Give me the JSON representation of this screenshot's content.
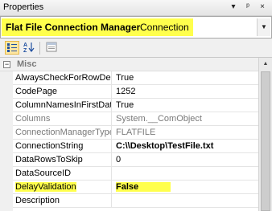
{
  "window": {
    "title": "Properties",
    "buttons": [
      "▾",
      "ᵖ",
      "×"
    ]
  },
  "object_selector": {
    "name": "Flat File Connection Manager",
    "type": "Connection",
    "highlight_color": "#ffff4d"
  },
  "toolbar": {
    "buttons": [
      {
        "name": "categorized-view-icon",
        "active": true
      },
      {
        "name": "alphabetical-sort-icon",
        "active": false
      },
      {
        "name": "property-pages-icon",
        "active": false
      }
    ]
  },
  "grid": {
    "category": {
      "toggle": "−",
      "label": "Misc"
    },
    "rows": [
      {
        "name": "AlwaysCheckForRowDelim",
        "value": "True",
        "readonly": false,
        "bold": false,
        "highlight": false
      },
      {
        "name": "CodePage",
        "value": "1252",
        "readonly": false,
        "bold": false,
        "highlight": false
      },
      {
        "name": "ColumnNamesInFirstDataRow",
        "value": "True",
        "readonly": false,
        "bold": false,
        "highlight": false
      },
      {
        "name": "Columns",
        "value": "System.__ComObject",
        "readonly": true,
        "bold": false,
        "highlight": false
      },
      {
        "name": "ConnectionManagerType",
        "value": "FLATFILE",
        "readonly": true,
        "bold": false,
        "highlight": false
      },
      {
        "name": "ConnectionString",
        "value": "C:\\\\Desktop\\TestFile.txt",
        "readonly": false,
        "bold": true,
        "highlight": false
      },
      {
        "name": "DataRowsToSkip",
        "value": "0",
        "readonly": false,
        "bold": false,
        "highlight": false
      },
      {
        "name": "DataSourceID",
        "value": "",
        "readonly": false,
        "bold": false,
        "highlight": false
      },
      {
        "name": "DelayValidation",
        "value": "False",
        "readonly": false,
        "bold": true,
        "highlight": true
      },
      {
        "name": "Description",
        "value": "",
        "readonly": false,
        "bold": false,
        "highlight": false
      }
    ]
  }
}
